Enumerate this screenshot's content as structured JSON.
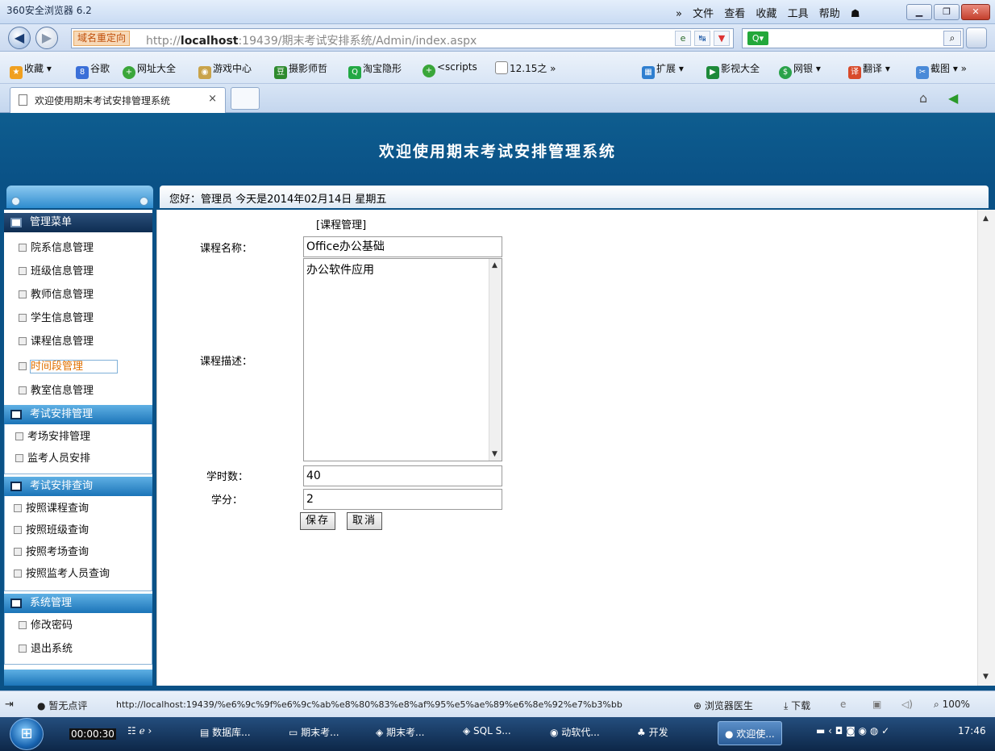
{
  "window": {
    "title": "360安全浏览器 6.2",
    "menus": [
      "文件",
      "查看",
      "收藏",
      "工具",
      "帮助"
    ]
  },
  "address_bar": {
    "redirect_badge": "域名重定向",
    "url_prefix": "http://",
    "url_host": "localhost",
    "url_rest": ":19439/期末考试安排系统/Admin/index.aspx"
  },
  "favorites": [
    {
      "label": "收藏",
      "icon": "star-icon"
    },
    {
      "label": "谷歌",
      "icon": "google-icon"
    },
    {
      "label": "网址大全",
      "icon": "globe-icon"
    },
    {
      "label": "游戏中心",
      "icon": "gamepad-icon"
    },
    {
      "label": "摄影师哲",
      "icon": "douban-icon"
    },
    {
      "label": "淘宝隐形",
      "icon": "search-icon"
    },
    {
      "label": "<scripts",
      "icon": "globe-icon"
    },
    {
      "label": "12.15之",
      "icon": "page-icon"
    },
    {
      "label": "扩展",
      "icon": "grid-icon"
    },
    {
      "label": "影视大全",
      "icon": "video-icon"
    },
    {
      "label": "网银",
      "icon": "bank-icon"
    },
    {
      "label": "翻译",
      "icon": "translate-icon"
    },
    {
      "label": "截图",
      "icon": "screenshot-icon"
    }
  ],
  "tab": {
    "label": "欢迎使用期末考试安排管理系统",
    "close": "×"
  },
  "page": {
    "banner_title": "欢迎使用期末考试安排管理系统",
    "status_text": "您好：管理员   今天是2014年02月14日   星期五"
  },
  "sidebar": {
    "sections": [
      {
        "title": "管理菜单",
        "items": [
          "院系信息管理",
          "班级信息管理",
          "教师信息管理",
          "学生信息管理",
          "课程信息管理",
          "时间段管理",
          "教室信息管理"
        ]
      },
      {
        "title": "考试安排管理",
        "items": [
          "考场安排管理",
          "监考人员安排"
        ]
      },
      {
        "title": "考试安排查询",
        "items": [
          "按照课程查询",
          "按照班级查询",
          "按照考场查询",
          "按照监考人员查询"
        ]
      },
      {
        "title": "系统管理",
        "items": [
          "修改密码",
          "退出系统"
        ]
      }
    ]
  },
  "form": {
    "breadcrumb": "[课程管理]",
    "course_name_label": "课程名称：",
    "course_name_value": "Office办公基础",
    "course_desc_label": "课程描述：",
    "course_desc_value": "办公软件应用",
    "hours_label": "学时数：",
    "hours_value": "40",
    "credit_label": "学分：",
    "credit_value": "2",
    "save_label": "保存",
    "cancel_label": "取消"
  },
  "browser_status": {
    "comments": "暂无点评",
    "status_url": "http://localhost:19439/%e6%9c%9f%e6%9c%ab%e8%80%83%e8%af%95%e5%ae%89%e6%8e%92%e7%b3%bb",
    "doctor": "浏览器医生",
    "download": "下载",
    "zoom": "100%"
  },
  "taskbar": {
    "timer": "00:00:30",
    "items": [
      "数据库...",
      "期末考...",
      "期末考...",
      "SQL S...",
      "动软代...",
      "开发"
    ],
    "active_item": "欢迎使...",
    "clock": "17:46"
  }
}
